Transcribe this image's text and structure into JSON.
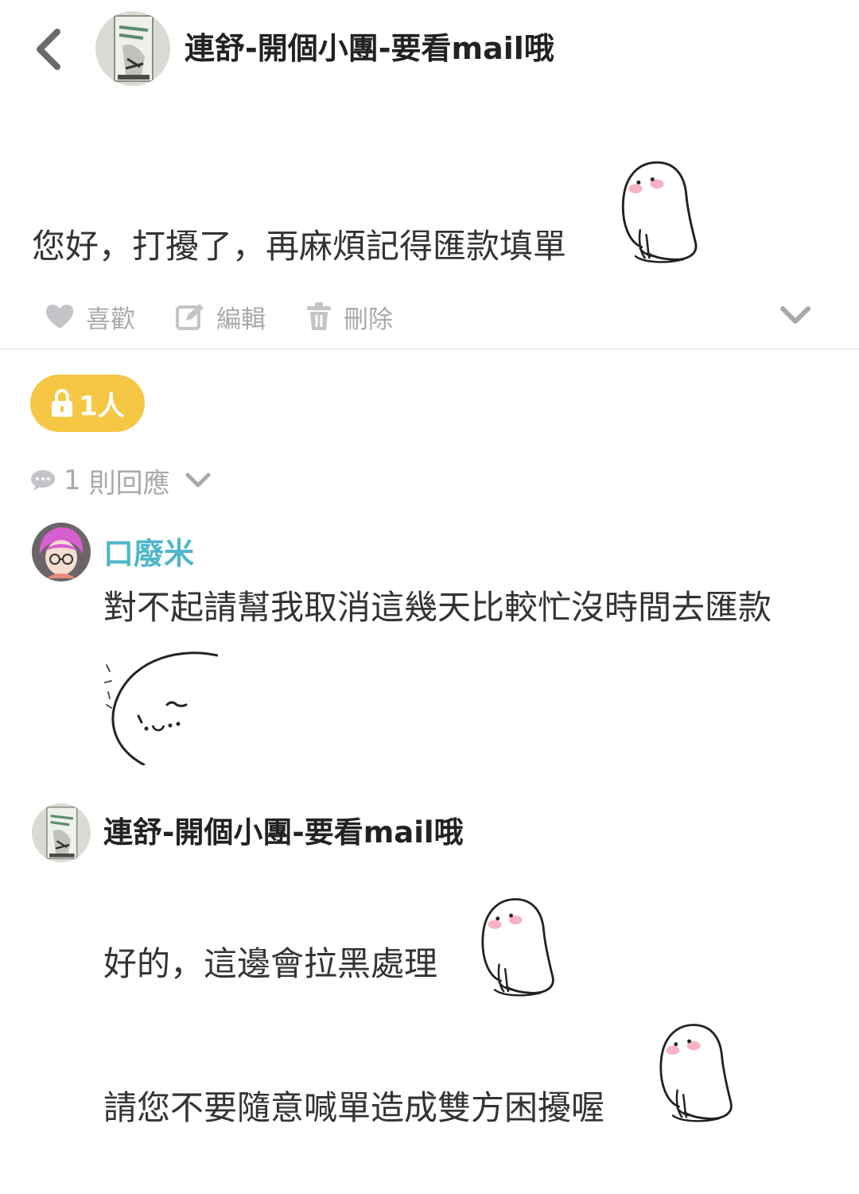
{
  "header": {
    "title": "連舒-開個小團-要看mail哦",
    "back_icon": "chevron-left-icon"
  },
  "post": {
    "text": "您好，打擾了，再麻煩記得匯款填單",
    "sticker": "blob-sticker-shy"
  },
  "actions": {
    "like": {
      "label": "喜歡",
      "icon": "heart-icon"
    },
    "edit": {
      "label": "編輯",
      "icon": "edit-icon"
    },
    "delete": {
      "label": "刪除",
      "icon": "trash-icon"
    },
    "more_icon": "chevron-down-icon"
  },
  "privacy_badge": {
    "count_label": "1人",
    "icon": "lock-icon",
    "color": "#f6c744"
  },
  "replies": {
    "count": "1",
    "label": "則回應",
    "toggle_icon": "chevron-down-icon",
    "items": [
      {
        "author": "口廢米",
        "author_color": "#4fb6c9",
        "text": "對不起請幫我取消這幾天比較忙沒時間去匯款",
        "sticker": "blob-sticker-peek"
      },
      {
        "author": "連舒-開個小團-要看mail哦",
        "lines": [
          "好的，這邊會拉黑處理",
          "請您不要隨意喊單造成雙方困擾喔"
        ],
        "sticker": "blob-sticker-shy"
      }
    ]
  },
  "colors": {
    "muted": "#a9a9ad",
    "text": "#333333",
    "divider": "#ececee"
  }
}
